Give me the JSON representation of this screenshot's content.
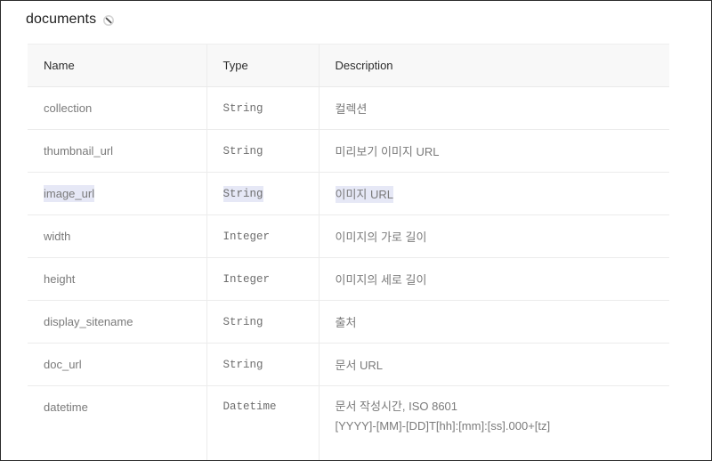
{
  "section": {
    "title": "documents",
    "icon": "link-icon"
  },
  "table": {
    "headers": {
      "name": "Name",
      "type": "Type",
      "description": "Description"
    },
    "rows": [
      {
        "name": "collection",
        "type": "String",
        "description": "컬렉션"
      },
      {
        "name": "thumbnail_url",
        "type": "String",
        "description": "미리보기 이미지 URL"
      },
      {
        "name": "image_url",
        "type": "String",
        "description": "이미지 URL",
        "selected": true
      },
      {
        "name": "width",
        "type": "Integer",
        "description": "이미지의 가로 길이"
      },
      {
        "name": "height",
        "type": "Integer",
        "description": "이미지의 세로 길이"
      },
      {
        "name": "display_sitename",
        "type": "String",
        "description": "출처"
      },
      {
        "name": "doc_url",
        "type": "String",
        "description": "문서 URL"
      },
      {
        "name": "datetime",
        "type": "Datetime",
        "description": "문서 작성시간, ISO 8601",
        "description_line2": "[YYYY]-[MM]-[DD]T[hh]:[mm]:[ss].000+[tz]"
      }
    ]
  },
  "colors": {
    "selection_highlight": "#e6e8f6",
    "header_background": "#f8f8f8",
    "border": "#ececec"
  }
}
